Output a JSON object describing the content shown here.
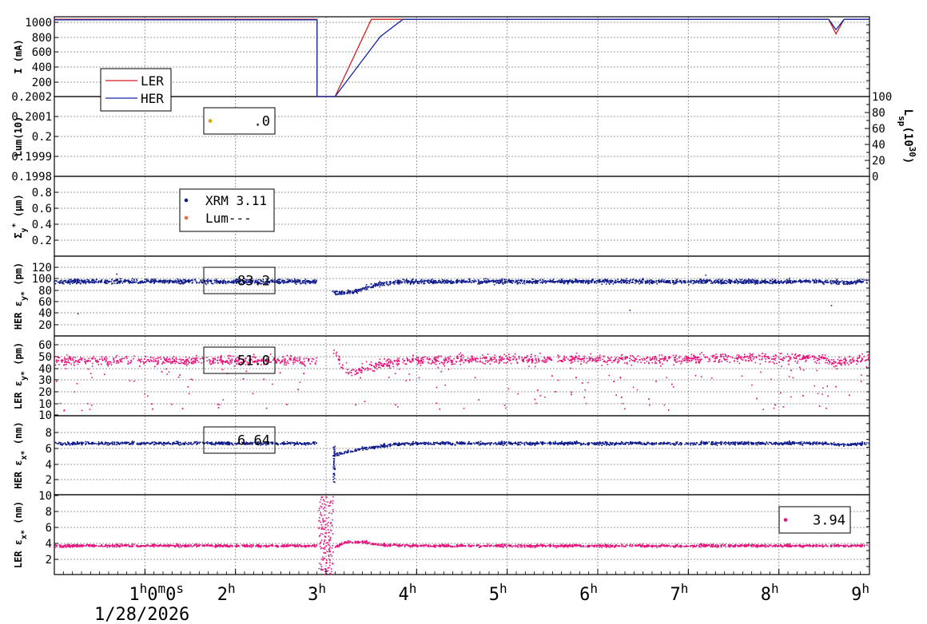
{
  "colors": {
    "ler": "#d41e1e",
    "her": "#1428a0",
    "ler_pink": "#e6137c",
    "her_navy": "#101c8c",
    "lum_gold": "#e0a000",
    "lum_orange": "#f0663c",
    "grid": "#9a9a9a"
  },
  "time_axis": {
    "ticks": [
      1,
      2,
      3,
      4,
      5,
      6,
      7,
      8,
      9
    ],
    "labels": [
      {
        "main": "1",
        "sup": "h",
        "rest": "0",
        "sup2": "m",
        "rest2": "0",
        "sup3": "s"
      },
      {
        "main": "2",
        "sup": "h"
      },
      {
        "main": "3",
        "sup": "h"
      },
      {
        "main": "4",
        "sup": "h"
      },
      {
        "main": "5",
        "sup": "h"
      },
      {
        "main": "6",
        "sup": "h"
      },
      {
        "main": "7",
        "sup": "h"
      },
      {
        "main": "8",
        "sup": "h"
      },
      {
        "main": "9",
        "sup": "h"
      }
    ],
    "date": "1/28/2026",
    "range": [
      0,
      9
    ]
  },
  "chart_data": [
    {
      "type": "line",
      "ylabel": "I (mA)",
      "yticks": [
        "200",
        "400",
        "600",
        "800",
        "1000"
      ],
      "ylim": [
        100,
        1030
      ],
      "grid": true,
      "legend": {
        "position": "bottom-left",
        "entries": [
          "LER",
          "HER"
        ]
      },
      "series": [
        {
          "name": "LER",
          "x": [
            0,
            2.9,
            2.9,
            3.1,
            3.5,
            3.65,
            8.55,
            8.63,
            8.72,
            9
          ],
          "y": [
            1000,
            1000,
            100,
            100,
            1000,
            1000,
            1000,
            830,
            1000,
            1000
          ]
        },
        {
          "name": "HER",
          "x": [
            0,
            2.9,
            2.9,
            3.1,
            3.6,
            3.85,
            8.55,
            8.63,
            8.72,
            9
          ],
          "y": [
            995,
            995,
            100,
            100,
            800,
            1000,
            1000,
            880,
            1000,
            1000
          ]
        }
      ]
    },
    {
      "type": "scatter",
      "ylabel_parts": [
        "Lum(10",
        ")"
      ],
      "yticks": [
        "0.1998",
        "0.1999",
        "0.2",
        "0.2001",
        "0.2002"
      ],
      "ylim": [
        0.1998,
        0.2002
      ],
      "y2label_parts": [
        "L",
        "sp",
        "(10",
        "30",
        ")"
      ],
      "y2ticks": [
        "0",
        "20",
        "40",
        "60",
        "80",
        "100"
      ],
      "y2lim": [
        0,
        100
      ],
      "grid": true,
      "legend": {
        "position": "top-left",
        "entries": [
          ".0"
        ]
      },
      "series": []
    },
    {
      "type": "scatter",
      "ylabel_parts": [
        "Σ",
        "y",
        "*",
        " (µm)"
      ],
      "yticks": [
        "0.2",
        "0.4",
        "0.6",
        "0.8"
      ],
      "ylim": [
        0,
        1
      ],
      "grid": true,
      "legend": {
        "position": "top-left",
        "entries": [
          "XRM 3.11",
          "Lum---"
        ]
      },
      "series": []
    },
    {
      "type": "scatter",
      "ylabel_parts": [
        "HER ε",
        "y*",
        " (pm)"
      ],
      "yticks": [
        "20",
        "40",
        "60",
        "80",
        "100",
        "120"
      ],
      "ylim": [
        0,
        135
      ],
      "grid": true,
      "legend": {
        "position": "top-left",
        "entries": [
          "83.2"
        ]
      },
      "series": [
        {
          "x": [
            0,
            0.5,
            1,
            1.5,
            2,
            2.5,
            2.9,
            3.08,
            3.15,
            3.3,
            3.45,
            3.6,
            3.8,
            4,
            4.5,
            5,
            5.5,
            6,
            6.5,
            7,
            7.5,
            8,
            8.5,
            8.7,
            9
          ],
          "y": [
            92,
            92,
            92,
            92,
            92,
            92,
            92,
            74,
            72,
            75,
            82,
            88,
            91,
            92,
            92,
            92,
            92,
            92,
            92,
            92,
            92,
            92,
            92,
            90,
            92
          ]
        }
      ]
    },
    {
      "type": "scatter",
      "ylabel_parts": [
        "LER ε",
        "y*",
        " (pm)"
      ],
      "yticks": [
        "10",
        "10",
        "20",
        "30",
        "40",
        "50",
        "60"
      ],
      "ylim": [
        0,
        65
      ],
      "grid": true,
      "legend": {
        "position": "top-left",
        "entries": [
          "51.0"
        ]
      },
      "series": [
        {
          "x": [
            0,
            0.5,
            1,
            1.5,
            2,
            2.5,
            2.9,
            3.1,
            3.2,
            3.3,
            3.5,
            3.8,
            4,
            4.5,
            5,
            5.5,
            6,
            6.5,
            7,
            7.5,
            8,
            8.5,
            8.6,
            9
          ],
          "y": [
            45,
            45,
            45,
            45,
            45,
            45,
            45,
            52,
            38,
            36,
            40,
            44,
            45,
            46,
            46,
            46,
            46,
            46,
            46,
            47,
            47,
            47,
            43,
            47
          ]
        }
      ]
    },
    {
      "type": "scatter",
      "ylabel_parts": [
        "HER ε",
        "x*",
        " (nm)"
      ],
      "yticks": [
        "2",
        "4",
        "6",
        "8"
      ],
      "ylim": [
        0,
        10
      ],
      "grid": true,
      "legend": {
        "position": "top-left",
        "entries": [
          "6.64"
        ]
      },
      "series": [
        {
          "x": [
            0,
            0.5,
            1,
            1.5,
            2,
            2.5,
            2.9,
            3.08,
            3.15,
            3.3,
            3.5,
            3.8,
            4,
            4.5,
            5,
            5.5,
            6,
            6.5,
            7,
            7.5,
            8,
            8.5,
            8.7,
            9
          ],
          "y": [
            6.5,
            6.5,
            6.5,
            6.5,
            6.5,
            6.5,
            6.5,
            5,
            5.2,
            5.6,
            6,
            6.4,
            6.5,
            6.5,
            6.5,
            6.5,
            6.5,
            6.5,
            6.5,
            6.5,
            6.5,
            6.5,
            6.3,
            6.5
          ]
        }
      ]
    },
    {
      "type": "scatter",
      "ylabel_parts": [
        "LER ε",
        "x*",
        " (nm)"
      ],
      "yticks": [
        "2",
        "4",
        "6",
        "8",
        "10"
      ],
      "ylim": [
        0,
        10
      ],
      "grid": true,
      "legend": {
        "position": "top-right",
        "entries": [
          "3.94"
        ]
      },
      "series": [
        {
          "x": [
            0,
            0.5,
            1,
            1.5,
            2,
            2.5,
            2.9,
            3.1,
            3.2,
            3.3,
            3.45,
            3.6,
            4,
            4.5,
            5,
            5.5,
            6,
            6.5,
            7,
            7.5,
            8,
            8.5,
            9
          ],
          "y": [
            3.6,
            3.6,
            3.6,
            3.6,
            3.6,
            3.6,
            3.6,
            3.4,
            4,
            4.1,
            4,
            3.7,
            3.6,
            3.6,
            3.6,
            3.6,
            3.6,
            3.6,
            3.6,
            3.6,
            3.6,
            3.6,
            3.6
          ]
        }
      ]
    }
  ]
}
